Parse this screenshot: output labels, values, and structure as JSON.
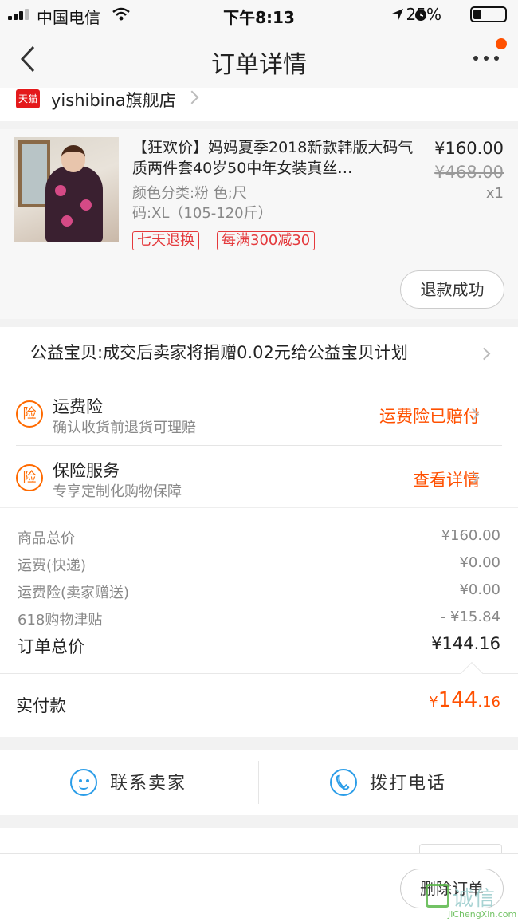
{
  "status_bar": {
    "carrier": "中国电信",
    "time": "下午8:13",
    "battery": "25%"
  },
  "nav": {
    "title": "订单详情"
  },
  "shop": {
    "badge": "天猫",
    "name": "yishibina旗舰店"
  },
  "product": {
    "title": "【狂欢价】妈妈夏季2018新款韩版大码气质两件套40岁50中年女装真丝…",
    "sku_line1": "颜色分类:粉 色;尺",
    "sku_line2": "码:XL（105-120斤）",
    "price": "¥160.00",
    "original_price": "¥468.00",
    "quantity": "x1",
    "tags": [
      "七天退换",
      "每满300减30"
    ],
    "status_button": "退款成功"
  },
  "charity": {
    "text": "公益宝贝:成交后卖家将捐赠0.02元给公益宝贝计划"
  },
  "insurance": [
    {
      "icon": "险",
      "title": "运费险",
      "subtitle": "确认收货前退货可理赔",
      "link": "运费险已赔付"
    },
    {
      "icon": "险",
      "title": "保险服务",
      "subtitle": "专享定制化购物保障",
      "link": "查看详情"
    }
  ],
  "summary": {
    "rows": [
      {
        "label": "商品总价",
        "value": "¥160.00"
      },
      {
        "label": "运费(快递)",
        "value": "¥0.00"
      },
      {
        "label": "运费险(卖家赠送)",
        "value": "¥0.00"
      },
      {
        "label": "618购物津贴",
        "value": "- ¥15.84"
      }
    ],
    "total_label": "订单总价",
    "total_value": "¥144.16"
  },
  "paid": {
    "label": "实付款",
    "currency": "¥",
    "integer": "144",
    "decimal": ".16"
  },
  "contact": {
    "seller": "联系卖家",
    "call": "拨打电话"
  },
  "bottom": {
    "delete_button": "删除订单"
  },
  "watermark": {
    "text": "诚信",
    "url_text": "JiChengXin.com"
  },
  "colors": {
    "accent": "#ff5000",
    "tmall": "#e4191b",
    "tag": "#e4393c",
    "contact_icon": "#2b9de8"
  }
}
